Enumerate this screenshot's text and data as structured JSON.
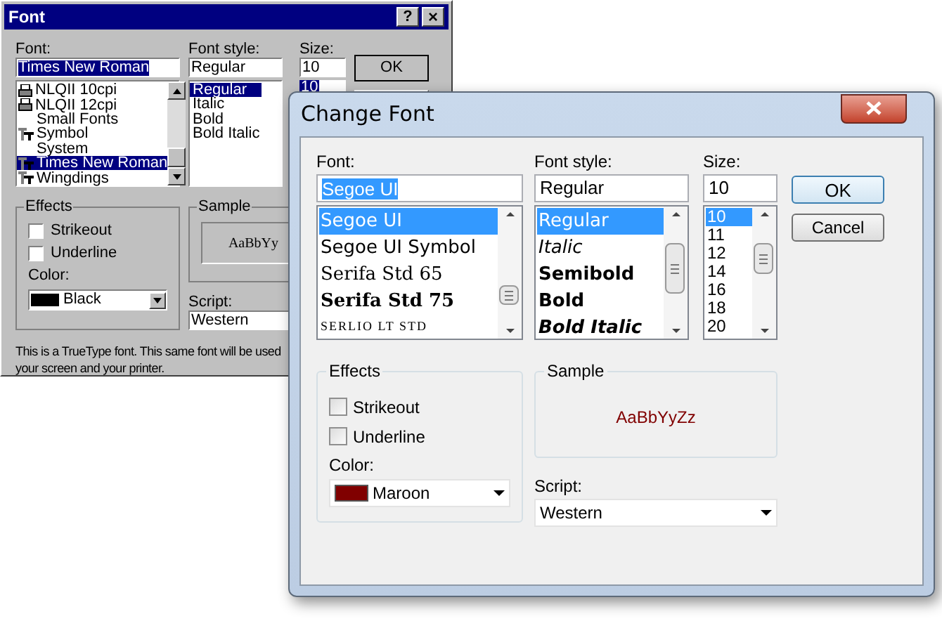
{
  "back_dialog": {
    "title": "Font",
    "help_button": "?",
    "close_button": "×",
    "font_label": "Font:",
    "font_value": "Times New Roman",
    "fonts": [
      {
        "name": "NLQII 10cpi",
        "kind": "printer",
        "selected": false
      },
      {
        "name": "NLQII 12cpi",
        "kind": "printer",
        "selected": false
      },
      {
        "name": "Small Fonts",
        "kind": "plain",
        "selected": false
      },
      {
        "name": "Symbol",
        "kind": "truetype",
        "selected": false
      },
      {
        "name": "System",
        "kind": "plain",
        "selected": false
      },
      {
        "name": "Times New Roman",
        "kind": "truetype",
        "selected": true
      },
      {
        "name": "Wingdings",
        "kind": "truetype",
        "selected": false
      }
    ],
    "style_label": "Font style:",
    "style_value": "Regular",
    "styles": [
      {
        "name": "Regular",
        "selected": true
      },
      {
        "name": "Italic",
        "selected": false
      },
      {
        "name": "Bold",
        "selected": false
      },
      {
        "name": "Bold Italic",
        "selected": false
      }
    ],
    "size_label": "Size:",
    "size_value": "10",
    "sizes": [
      {
        "name": "10",
        "selected": true
      }
    ],
    "ok_button": "OK",
    "effects": {
      "title": "Effects",
      "options": [
        {
          "label": "Strikeout",
          "checked": false
        },
        {
          "label": "Underline",
          "checked": false
        }
      ],
      "color_label": "Color:",
      "color_name": "Black",
      "color": "#000000"
    },
    "sample": {
      "title": "Sample",
      "text": "AaBbYy"
    },
    "script_label": "Script:",
    "script_value": "Western",
    "description": [
      "This is a TrueType font. This same font will be used",
      "your screen and your printer."
    ]
  },
  "front_dialog": {
    "title": "Change Font",
    "font_label": "Font:",
    "font_value": "Segoe UI",
    "fonts": [
      {
        "name": "Segoe UI",
        "kind": "sans",
        "selected": true
      },
      {
        "name": "Segoe UI Symbol",
        "kind": "sans",
        "selected": false
      },
      {
        "name": "Serifa Std 65",
        "kind": "serif",
        "selected": false
      },
      {
        "name": "Serifa Std 75",
        "kind": "serif_bold",
        "selected": false
      },
      {
        "name": "SERLIO LT STD",
        "kind": "small_caps",
        "selected": false
      }
    ],
    "style_label": "Font style:",
    "style_value": "Regular",
    "styles": [
      {
        "name": "Regular",
        "kind": "regular",
        "selected": true
      },
      {
        "name": "Italic",
        "kind": "italic",
        "selected": false
      },
      {
        "name": "Semibold",
        "kind": "semibold",
        "selected": false
      },
      {
        "name": "Bold",
        "kind": "bold",
        "selected": false
      },
      {
        "name": "Bold Italic",
        "kind": "bold_italic",
        "selected": false
      }
    ],
    "size_label": "Size:",
    "size_value": "10",
    "sizes": [
      {
        "name": "10",
        "selected": true
      },
      {
        "name": "11",
        "selected": false
      },
      {
        "name": "12",
        "selected": false
      },
      {
        "name": "14",
        "selected": false
      },
      {
        "name": "16",
        "selected": false
      },
      {
        "name": "18",
        "selected": false
      },
      {
        "name": "20",
        "selected": false
      }
    ],
    "ok_button": "OK",
    "cancel_button": "Cancel",
    "effects": {
      "title": "Effects",
      "options": [
        {
          "label": "Strikeout",
          "checked": false
        },
        {
          "label": "Underline",
          "checked": false
        }
      ],
      "color_label": "Color:",
      "color_name": "Maroon",
      "color": "#800000"
    },
    "sample": {
      "title": "Sample",
      "text": "AaBbYyZz"
    },
    "script_label": "Script:",
    "script_value": "Western"
  }
}
